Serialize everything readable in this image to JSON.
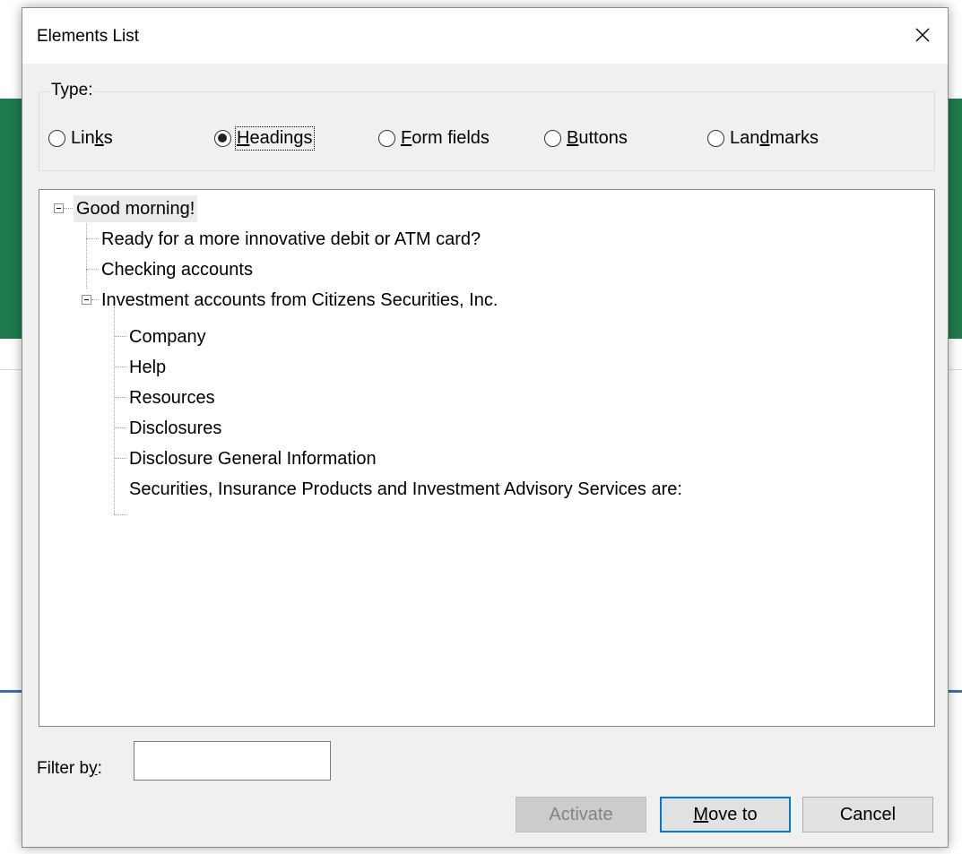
{
  "dialog": {
    "title": "Elements List",
    "close_icon": "close-icon"
  },
  "type_group": {
    "legend": "Type:",
    "options": [
      {
        "pre": "Lin",
        "key": "k",
        "post": "s",
        "checked": false
      },
      {
        "pre": "",
        "key": "H",
        "post": "eadings",
        "checked": true
      },
      {
        "pre": "",
        "key": "F",
        "post": "orm fields",
        "checked": false
      },
      {
        "pre": "",
        "key": "B",
        "post": "uttons",
        "checked": false
      },
      {
        "pre": "Lan",
        "key": "d",
        "post": "marks",
        "checked": false
      }
    ]
  },
  "tree": {
    "items": [
      {
        "label": "Good morning!",
        "level": 0,
        "expanded": true,
        "selected": true
      },
      {
        "label": "Ready for a more innovative debit or ATM card?",
        "level": 1
      },
      {
        "label": "Checking accounts",
        "level": 1
      },
      {
        "label": "Investment accounts from Citizens Securities, Inc.",
        "level": 1,
        "expanded": true
      },
      {
        "label": "Company",
        "level": 2
      },
      {
        "label": "Help",
        "level": 2
      },
      {
        "label": "Resources",
        "level": 2
      },
      {
        "label": "Disclosures",
        "level": 2
      },
      {
        "label": "Disclosure General Information",
        "level": 2
      },
      {
        "label": "Securities, Insurance Products and Investment Advisory Services are:",
        "level": 2
      }
    ]
  },
  "filter": {
    "label_pre": "Filter b",
    "label_key": "y",
    "label_post": ":",
    "value": ""
  },
  "buttons": {
    "activate": "Activate",
    "move_to_key": "M",
    "move_to_rest": "ove to",
    "cancel": "Cancel"
  },
  "colors": {
    "accent": "#0078d7",
    "background_green": "#1f7a4d"
  }
}
